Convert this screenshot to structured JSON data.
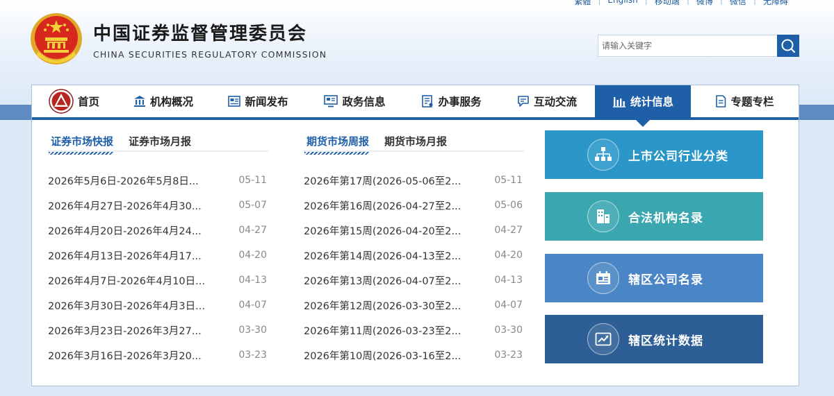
{
  "top_links": [
    "繁體",
    "English",
    "移动端",
    "微博",
    "微信",
    "无障碍"
  ],
  "site": {
    "title": "中国证券监督管理委员会",
    "subtitle": "CHINA SECURITIES REGULATORY COMMISSION"
  },
  "search": {
    "placeholder": "请输入关键字"
  },
  "nav": [
    {
      "label": "首页",
      "icon": "emblem-icon"
    },
    {
      "label": "机构概况",
      "icon": "building-icon"
    },
    {
      "label": "新闻发布",
      "icon": "news-icon"
    },
    {
      "label": "政务信息",
      "icon": "monitor-icon"
    },
    {
      "label": "办事服务",
      "icon": "document-icon"
    },
    {
      "label": "互动交流",
      "icon": "chat-icon"
    },
    {
      "label": "统计信息",
      "icon": "bar-chart-icon",
      "active": true
    },
    {
      "label": "专题专栏",
      "icon": "file-icon"
    }
  ],
  "left_panel": {
    "tabs": [
      "证券市场快报",
      "证券市场月报"
    ],
    "items": [
      {
        "title": "2026年5月6日-2026年5月8日...",
        "date": "05-11"
      },
      {
        "title": "2026年4月27日-2026年4月30...",
        "date": "05-07"
      },
      {
        "title": "2026年4月20日-2026年4月24...",
        "date": "04-27"
      },
      {
        "title": "2026年4月13日-2026年4月17...",
        "date": "04-20"
      },
      {
        "title": "2026年4月7日-2026年4月10日...",
        "date": "04-13"
      },
      {
        "title": "2026年3月30日-2026年4月3日...",
        "date": "04-07"
      },
      {
        "title": "2026年3月23日-2026年3月27...",
        "date": "03-30"
      },
      {
        "title": "2026年3月16日-2026年3月20...",
        "date": "03-23"
      }
    ]
  },
  "middle_panel": {
    "tabs": [
      "期货市场周报",
      "期货市场月报"
    ],
    "items": [
      {
        "title": "2026年第17周(2026-05-06至2...",
        "date": "05-11"
      },
      {
        "title": "2026年第16周(2026-04-27至2...",
        "date": "05-06"
      },
      {
        "title": "2026年第15周(2026-04-20至2...",
        "date": "04-27"
      },
      {
        "title": "2026年第14周(2026-04-13至2...",
        "date": "04-20"
      },
      {
        "title": "2026年第13周(2026-04-07至2...",
        "date": "04-13"
      },
      {
        "title": "2026年第12周(2026-03-30至2...",
        "date": "04-07"
      },
      {
        "title": "2026年第11周(2026-03-23至2...",
        "date": "03-30"
      },
      {
        "title": "2026年第10周(2026-03-16至2...",
        "date": "03-23"
      }
    ]
  },
  "quick_links": [
    {
      "label": "上市公司行业分类",
      "icon": "org-chart-icon",
      "color": "#2a97c8"
    },
    {
      "label": "合法机构名录",
      "icon": "buildings-icon",
      "color": "#3aa6b0"
    },
    {
      "label": "辖区公司名录",
      "icon": "id-card-icon",
      "color": "#4a86c5"
    },
    {
      "label": "辖区统计数据",
      "icon": "trend-chart-icon",
      "color": "#2d5f96"
    }
  ]
}
